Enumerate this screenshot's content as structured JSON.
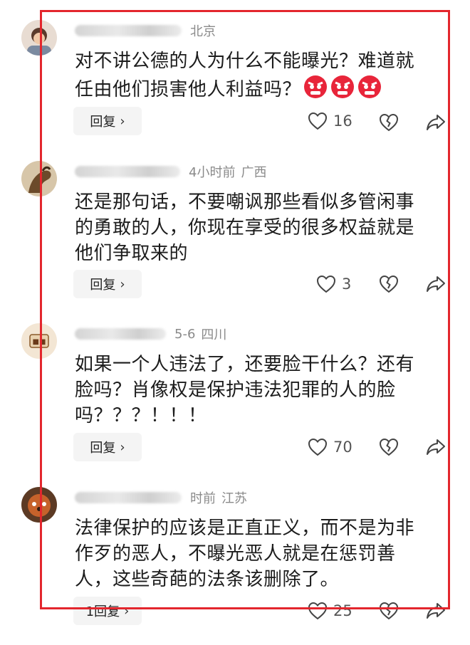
{
  "comments": [
    {
      "location": "北京",
      "time": "",
      "text": "对不讲公德的人为什么不能曝光？难道就任由他们损害他人利益吗？",
      "emoji_count": 3,
      "emoji_icon": "angry-face-icon",
      "reply_label": "回复",
      "likes": "16"
    },
    {
      "location": "广西",
      "time": "4小时前",
      "text": "还是那句话，不要嘲讽那些看似多管闲事的勇敢的人，你现在享受的很多权益就是他们争取来的",
      "reply_label": "回复",
      "likes": "3"
    },
    {
      "location": "四川",
      "time": "5-6",
      "text": "如果一个人违法了，还要脸干什么？还有脸吗？肖像权是保护违法犯罪的人的脸吗？？？！！！",
      "reply_label": "回复",
      "likes": "70"
    },
    {
      "location": "江苏",
      "time": "时前",
      "text": "法律保护的应该是正直正义，而不是为非作歹的恶人，不曝光恶人就是在惩罚善人，这些奇葩的法条该删除了。",
      "reply_label": "1回复",
      "likes": "25"
    }
  ],
  "icons": {
    "like": "heart-outline-icon",
    "dislike": "broken-heart-icon",
    "share": "share-arrow-icon"
  },
  "colors": {
    "highlight_frame": "#e3262d",
    "meta_text": "#8a8a8a",
    "reply_bg": "#f4f4f4"
  }
}
